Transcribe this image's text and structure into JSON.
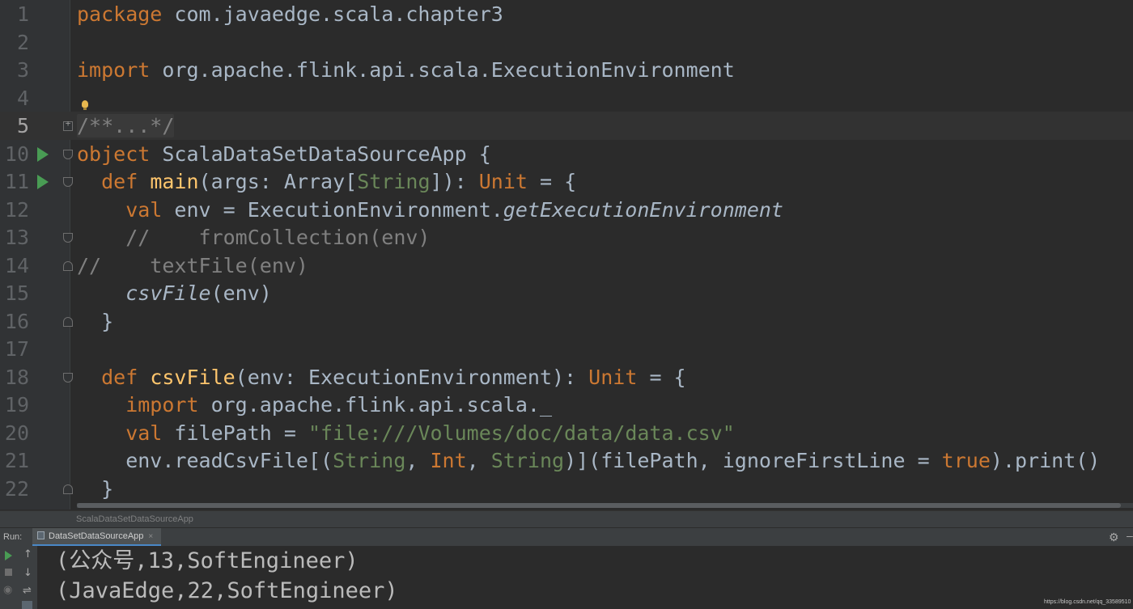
{
  "editor": {
    "active_line": "5",
    "lines": [
      {
        "num": "1",
        "tokens": [
          {
            "t": "package",
            "c": "kw"
          },
          {
            "t": " com.javaedge.scala.chapter3",
            "c": ""
          }
        ]
      },
      {
        "num": "2",
        "tokens": []
      },
      {
        "num": "3",
        "tokens": [
          {
            "t": "import",
            "c": "kw"
          },
          {
            "t": " org.apache.flink.api.scala.ExecutionEnvironment",
            "c": ""
          }
        ]
      },
      {
        "num": "4",
        "tokens": []
      },
      {
        "num": "5",
        "tokens": [
          {
            "t": "/**...*/",
            "c": "cm folded"
          }
        ]
      },
      {
        "num": "10",
        "tokens": [
          {
            "t": "object",
            "c": "kw"
          },
          {
            "t": " ScalaDataSetDataSourceApp {",
            "c": ""
          }
        ]
      },
      {
        "num": "11",
        "tokens": [
          {
            "t": "  def ",
            "c": "kw"
          },
          {
            "t": "main",
            "c": "fn"
          },
          {
            "t": "(args: Array[",
            "c": ""
          },
          {
            "t": "String",
            "c": "ty-green"
          },
          {
            "t": "]): ",
            "c": ""
          },
          {
            "t": "Unit",
            "c": "kw"
          },
          {
            "t": " = {",
            "c": ""
          }
        ]
      },
      {
        "num": "12",
        "tokens": [
          {
            "t": "    val",
            "c": "kw"
          },
          {
            "t": " env = ExecutionEnvironment.",
            "c": ""
          },
          {
            "t": "getExecutionEnvironment",
            "c": "it"
          }
        ]
      },
      {
        "num": "13",
        "tokens": [
          {
            "t": "    //    fromCollection(env)",
            "c": "cm"
          }
        ]
      },
      {
        "num": "14",
        "tokens": [
          {
            "t": "//    textFile(env)",
            "c": "cm"
          }
        ]
      },
      {
        "num": "15",
        "tokens": [
          {
            "t": "    ",
            "c": ""
          },
          {
            "t": "csvFile",
            "c": "it"
          },
          {
            "t": "(env)",
            "c": ""
          }
        ]
      },
      {
        "num": "16",
        "tokens": [
          {
            "t": "  }",
            "c": ""
          }
        ]
      },
      {
        "num": "17",
        "tokens": []
      },
      {
        "num": "18",
        "tokens": [
          {
            "t": "  def ",
            "c": "kw"
          },
          {
            "t": "csvFile",
            "c": "fn"
          },
          {
            "t": "(env: ExecutionEnvironment): ",
            "c": ""
          },
          {
            "t": "Unit",
            "c": "kw"
          },
          {
            "t": " = {",
            "c": ""
          }
        ]
      },
      {
        "num": "19",
        "tokens": [
          {
            "t": "    import",
            "c": "kw"
          },
          {
            "t": " org.apache.flink.api.scala._",
            "c": ""
          }
        ]
      },
      {
        "num": "20",
        "tokens": [
          {
            "t": "    val",
            "c": "kw"
          },
          {
            "t": " filePath = ",
            "c": ""
          },
          {
            "t": "\"file:///Volumes/doc/data/data.csv\"",
            "c": "str"
          }
        ]
      },
      {
        "num": "21",
        "tokens": [
          {
            "t": "    env.readCsvFile[(",
            "c": ""
          },
          {
            "t": "String",
            "c": "ty-green"
          },
          {
            "t": ", ",
            "c": ""
          },
          {
            "t": "Int",
            "c": "kw"
          },
          {
            "t": ", ",
            "c": ""
          },
          {
            "t": "String",
            "c": "ty-green"
          },
          {
            "t": ")](filePath, ignoreFirstLine = ",
            "c": ""
          },
          {
            "t": "true",
            "c": "kw"
          },
          {
            "t": ").print()",
            "c": ""
          }
        ]
      },
      {
        "num": "22",
        "tokens": [
          {
            "t": "  }",
            "c": ""
          }
        ]
      }
    ]
  },
  "breadcrumb": "ScalaDataSetDataSourceApp",
  "run_panel": {
    "label": "Run:",
    "tab_label": "DataSetDataSourceApp",
    "tab_close": "×",
    "output": [
      "(公众号,13,SoftEngineer)",
      "(JavaEdge,22,SoftEngineer)"
    ]
  },
  "watermark": "https://blog.csdn.net/qq_33589510"
}
